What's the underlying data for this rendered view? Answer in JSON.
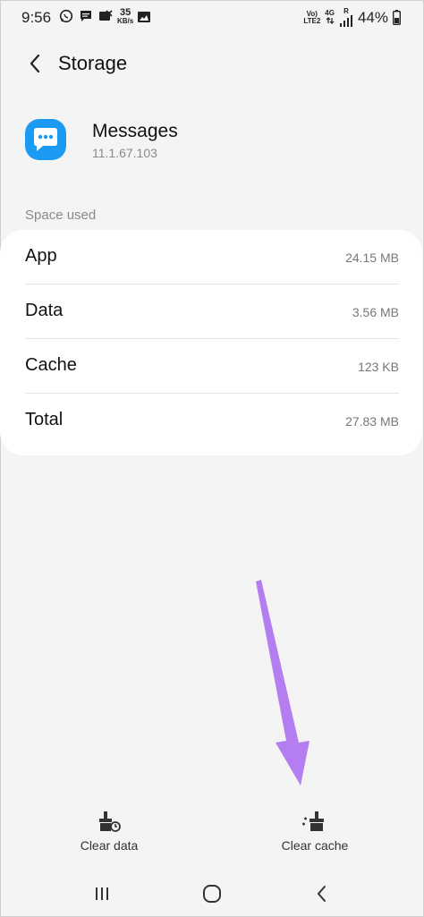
{
  "status_bar": {
    "time": "9:56",
    "net_speed_value": "35",
    "net_speed_unit": "KB/s",
    "volte_label": "Vo)",
    "lte_label": "LTE2",
    "network_type": "4G",
    "roaming_label": "R",
    "battery_percent": "44%"
  },
  "header": {
    "title": "Storage"
  },
  "app": {
    "name": "Messages",
    "version": "11.1.67.103"
  },
  "section": {
    "label": "Space used"
  },
  "storage_rows": [
    {
      "label": "App",
      "value": "24.15 MB"
    },
    {
      "label": "Data",
      "value": "3.56 MB"
    },
    {
      "label": "Cache",
      "value": "123 KB"
    },
    {
      "label": "Total",
      "value": "27.83 MB"
    }
  ],
  "actions": {
    "clear_data": "Clear data",
    "clear_cache": "Clear cache"
  },
  "colors": {
    "app_icon": "#1a9af3",
    "arrow": "#b57ef0"
  }
}
